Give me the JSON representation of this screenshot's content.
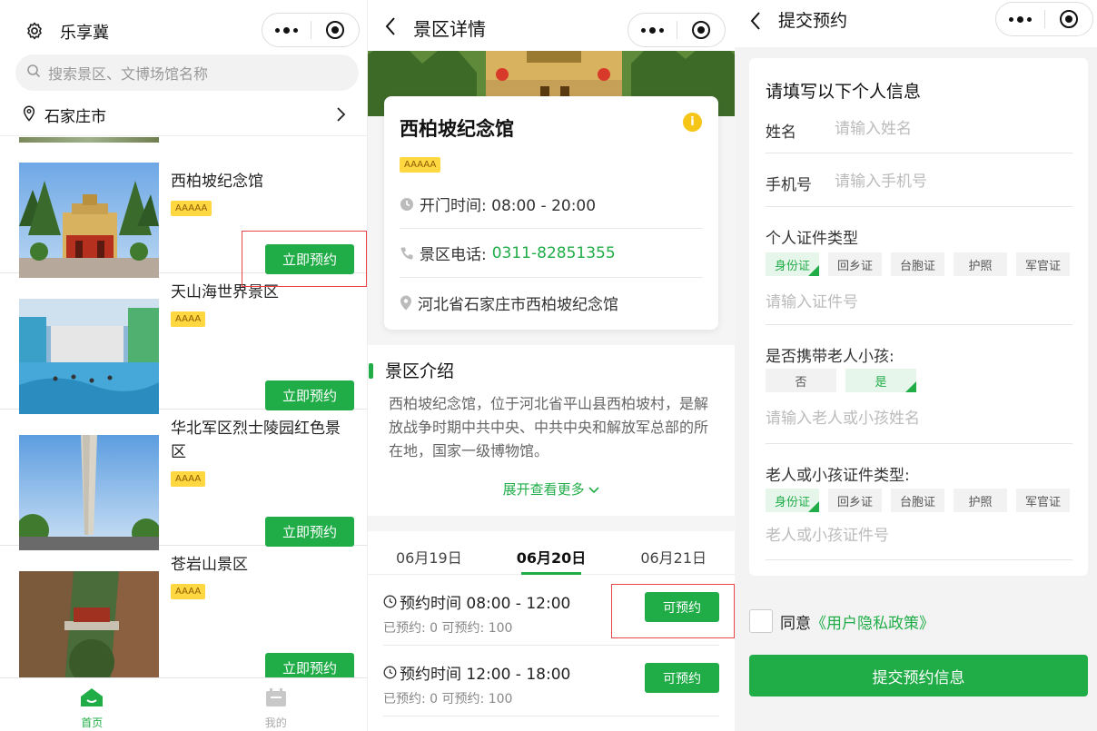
{
  "colors": {
    "accent": "#20ad48",
    "badge": "#ffd740",
    "highlight": "#e8454a"
  },
  "home": {
    "app_title": "乐享冀",
    "search_placeholder": "搜索景区、文博场馆名称",
    "city": "石家庄市",
    "book_label": "立即预约",
    "spots": [
      {
        "name": "西柏坡纪念馆",
        "level": "AAAAA"
      },
      {
        "name": "天山海世界景区",
        "level": "AAAA"
      },
      {
        "name": "华北军区烈士陵园红色景区",
        "level": "AAAA"
      },
      {
        "name": "苍岩山景区",
        "level": "AAAA"
      }
    ],
    "tabs": [
      {
        "label": "首页"
      },
      {
        "label": "我的"
      }
    ]
  },
  "detail": {
    "page_title": "景区详情",
    "name": "西柏坡纪念馆",
    "level": "AAAAA",
    "info_icon": "i",
    "hours": "开门时间: 08:00 - 20:00",
    "phone_label": "景区电话:",
    "phone": "0311-82851355",
    "address": "河北省石家庄市西柏坡纪念馆",
    "intro_title": "景区介绍",
    "intro_text": "西柏坡纪念馆，位于河北省平山县西柏坡村，是解放战争时期中共中央、中共中央和解放军总部的所在地，国家一级博物馆。",
    "more": "展开查看更多",
    "dates": [
      "06月19日",
      "06月20日",
      "06月21日"
    ],
    "slots": [
      {
        "time": "预约时间 08:00 - 12:00",
        "stat": "已预约: 0   可预约: 100",
        "button": "可预约"
      },
      {
        "time": "预约时间 12:00 - 18:00",
        "stat": "已预约: 0   可预约: 100",
        "button": "可预约"
      }
    ]
  },
  "form": {
    "page_title": "提交预约",
    "heading": "请填写以下个人信息",
    "name_label": "姓名",
    "name_placeholder": "请输入姓名",
    "phone_label": "手机号",
    "phone_placeholder": "请输入手机号",
    "id_type_label": "个人证件类型",
    "id_types": [
      "身份证",
      "回乡证",
      "台胞证",
      "护照",
      "军官证"
    ],
    "id_placeholder": "请输入证件号",
    "companion_label": "是否携带老人小孩:",
    "companion_options": [
      "否",
      "是"
    ],
    "companion_name_placeholder": "请输入老人或小孩姓名",
    "companion_id_type_label": "老人或小孩证件类型:",
    "companion_id_placeholder": "老人或小孩证件号",
    "agree_prefix": "同意",
    "agree_link": "《用户隐私政策》",
    "submit": "提交预约信息"
  }
}
